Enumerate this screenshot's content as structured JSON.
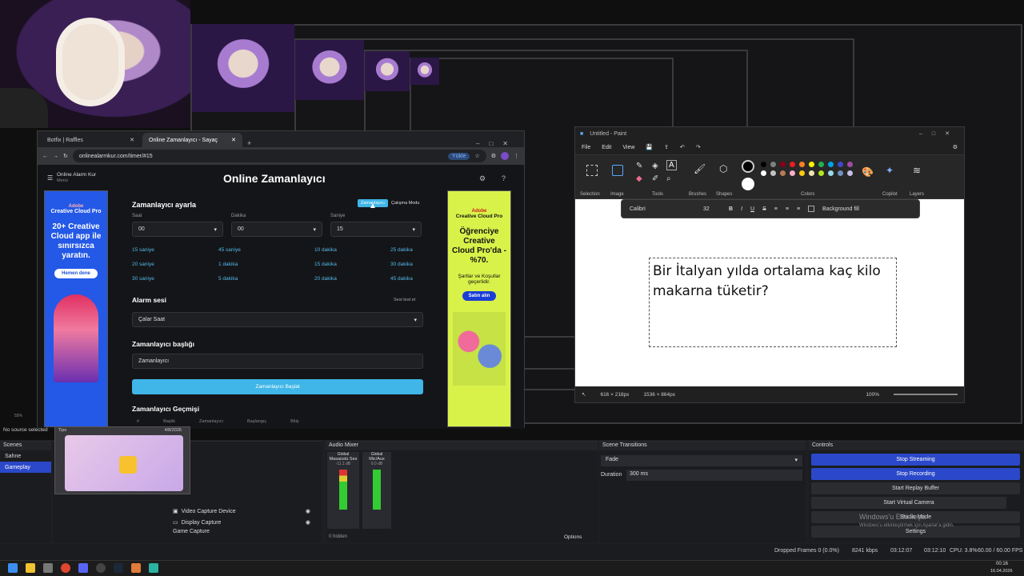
{
  "browser": {
    "tabs": [
      "Botfix | Raffles",
      "Online Zamanlayıcı - Sayaç"
    ],
    "url": "onlinealarmkur.com/timer/#15",
    "install_btn": "Yükle",
    "site_name": "Online Alarm Kur",
    "site_menu": "Menü",
    "page_title": "Online Zamanlayıcı",
    "settings_title": "Zamanlayıcı ayarla",
    "mode_toggle": [
      "Zamanlayıcı",
      "Çalışma Modu"
    ],
    "labels": {
      "hour": "Saat",
      "minute": "Dakika",
      "second": "Saniye"
    },
    "values": {
      "hour": "00",
      "minute": "00",
      "second": "15"
    },
    "quick_timers": [
      [
        "15 saniye",
        "45 saniye",
        "10 dakika",
        "25 dakika"
      ],
      [
        "20 saniye",
        "1 dakika",
        "15 dakika",
        "30 dakika"
      ],
      [
        "30 saniye",
        "5 dakika",
        "20 dakika",
        "45 dakika"
      ]
    ],
    "alarm_title": "Alarm sesi",
    "sound_test": "Sesi test et",
    "alarm_value": "Çalar Saat",
    "timer_title_label": "Zamanlayıcı başlığı",
    "timer_title_value": "Zamanlayıcı",
    "start_btn": "Zamanlayıcı Başlat",
    "history_title": "Zamanlayıcı Geçmişi",
    "history_headers": [
      "#",
      "Başlık",
      "Zamanlayıcı",
      "Başlangıç",
      "Bitiş"
    ],
    "ad_left": {
      "brand": "Adobe",
      "product": "Creative Cloud Pro",
      "headline": "20+ Creative Cloud app ile sınırsızca yaratın.",
      "cta": "Hemen dene"
    },
    "ad_right": {
      "brand": "Adobe",
      "product": "Creative Cloud Pro",
      "headline": "Öğrenciye Creative Cloud Pro'da -%70.",
      "sub": "Şartlar ve Koşullar geçerlidir.",
      "cta": "Satın alın"
    }
  },
  "paint": {
    "title": "Untitled - Paint",
    "menu": [
      "File",
      "Edit",
      "View"
    ],
    "groups": [
      "Selection",
      "Image",
      "Tools",
      "Brushes",
      "Shapes",
      "Colors",
      "Copilot",
      "Layers"
    ],
    "font": "Calibri",
    "font_size": "32",
    "bg_fill": "Background fill",
    "text": "Bir İtalyan yılda ortalama kaç kilo makarna tüketir?",
    "status_sel": "616 × 218px",
    "status_canvas": "1536 × 864px",
    "zoom": "100%",
    "palette": [
      "#000000",
      "#7f7f7f",
      "#880015",
      "#ed1c24",
      "#ff7f27",
      "#fff200",
      "#22b14c",
      "#00a2e8",
      "#3f48cc",
      "#a349a4",
      "#ffffff",
      "#c3c3c3",
      "#b97a57",
      "#ffaec9",
      "#ffc90e",
      "#efe4b0",
      "#b5e61d",
      "#99d9ea",
      "#7092be",
      "#c8bfe7"
    ]
  },
  "obs": {
    "scenes_title": "Scenes",
    "scenes": [
      "Sahne",
      "Gameplay"
    ],
    "no_source": "No source selected",
    "zoom": "55%",
    "sources": [
      "Video Capture Device",
      "Display Capture",
      "Game Capture"
    ],
    "tooltip_date": "4/8/2026",
    "tooltip_label": "Tips",
    "mixer_title": "Audio Mixer",
    "mixer_channels": [
      {
        "scope": "Global",
        "name": "Masaüstü Ses",
        "db": "-11.1 dB"
      },
      {
        "scope": "Global",
        "name": "Mic/Aux",
        "db": "0.0 dB"
      }
    ],
    "hidden": "0 hidden",
    "options": "Options",
    "transitions_title": "Scene Transitions",
    "transition": "Fade",
    "duration_label": "Duration",
    "duration": "300 ms",
    "controls_title": "Controls",
    "controls": [
      "Stop Streaming",
      "Stop Recording",
      "Start Replay Buffer",
      "Start Virtual Camera",
      "Studio Mode",
      "Settings"
    ],
    "watermark1": "Windows'u Etkinleştir",
    "watermark2": "Windows'u etkinleştirmek için Ayarlar'a gidin.",
    "status": {
      "dropped": "Dropped Frames 0 (0.0%)",
      "kbps": "8241 kbps",
      "stream_time": "03:12:07",
      "rec_time": "03:12:10",
      "cpu": "CPU: 3.8%",
      "fps": "60.00 / 60.00 FPS"
    }
  },
  "taskbar": {
    "time": "00:16",
    "date": "16.04.2026"
  }
}
